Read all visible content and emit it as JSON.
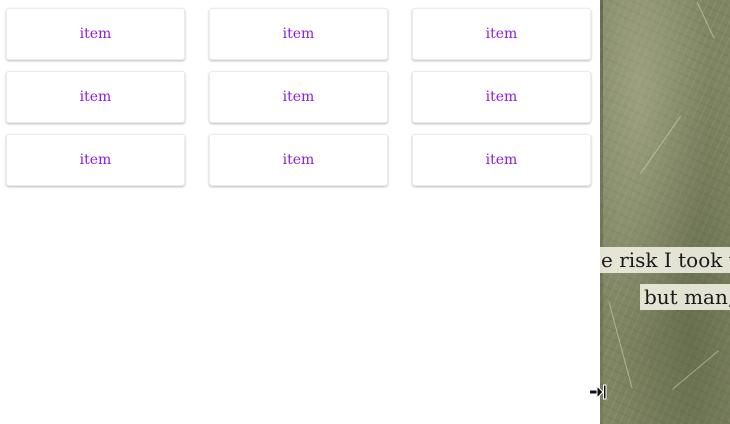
{
  "grid": {
    "items": [
      {
        "label": "item"
      },
      {
        "label": "item"
      },
      {
        "label": "item"
      },
      {
        "label": "item"
      },
      {
        "label": "item"
      },
      {
        "label": "item"
      },
      {
        "label": "item"
      },
      {
        "label": "item"
      },
      {
        "label": "item"
      }
    ],
    "label_color": "#8a1de0"
  },
  "side_image": {
    "quote_lines": [
      "e risk I took w",
      "but man,"
    ],
    "background_color": "#7f8563"
  },
  "cursor": {
    "icon": "resize-right-cursor-icon"
  }
}
